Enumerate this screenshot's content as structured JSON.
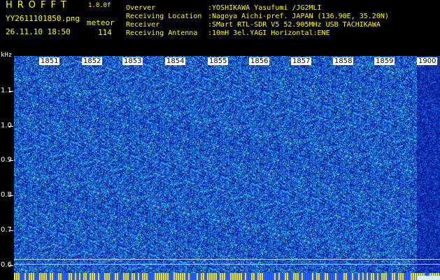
{
  "header": {
    "app_name": "HROFFT",
    "version": "1.0.0f",
    "filename": "YY2611101850.png",
    "timestamp": "26.11.10 18:50",
    "meteor_label": "meteor",
    "meteor_count": "114"
  },
  "info": [
    {
      "label": "Overver",
      "value": ":YOSHIKAWA Yasufumi /JG2MLI"
    },
    {
      "label": "Receiving Location",
      "value": ":Nagoya Aichi-pref. JAPAN (136.90E, 35.20N)"
    },
    {
      "label": "Receiver",
      "value": ":SMart RTL-SDR V5 52.905MHz USB TACHIKAWA"
    },
    {
      "label": "Receiving Antenna",
      "value": ":10mH 3el.YAGI Horizontal:ENE"
    }
  ],
  "spectrogram": {
    "y_unit": "kHz",
    "y_ticks": [
      "1.1",
      "1.0",
      "0.9",
      "0.8",
      "0.7",
      "0.6"
    ],
    "x_ticks": [
      "1851",
      "1852",
      "1853",
      "1854",
      "1855",
      "1856",
      "1857",
      "1858",
      "1859",
      "1900"
    ],
    "colors": {
      "background": "#0a1f8f",
      "mid": "#1f6fff",
      "high": "#27e0e0",
      "peak": "#ffff00"
    }
  }
}
